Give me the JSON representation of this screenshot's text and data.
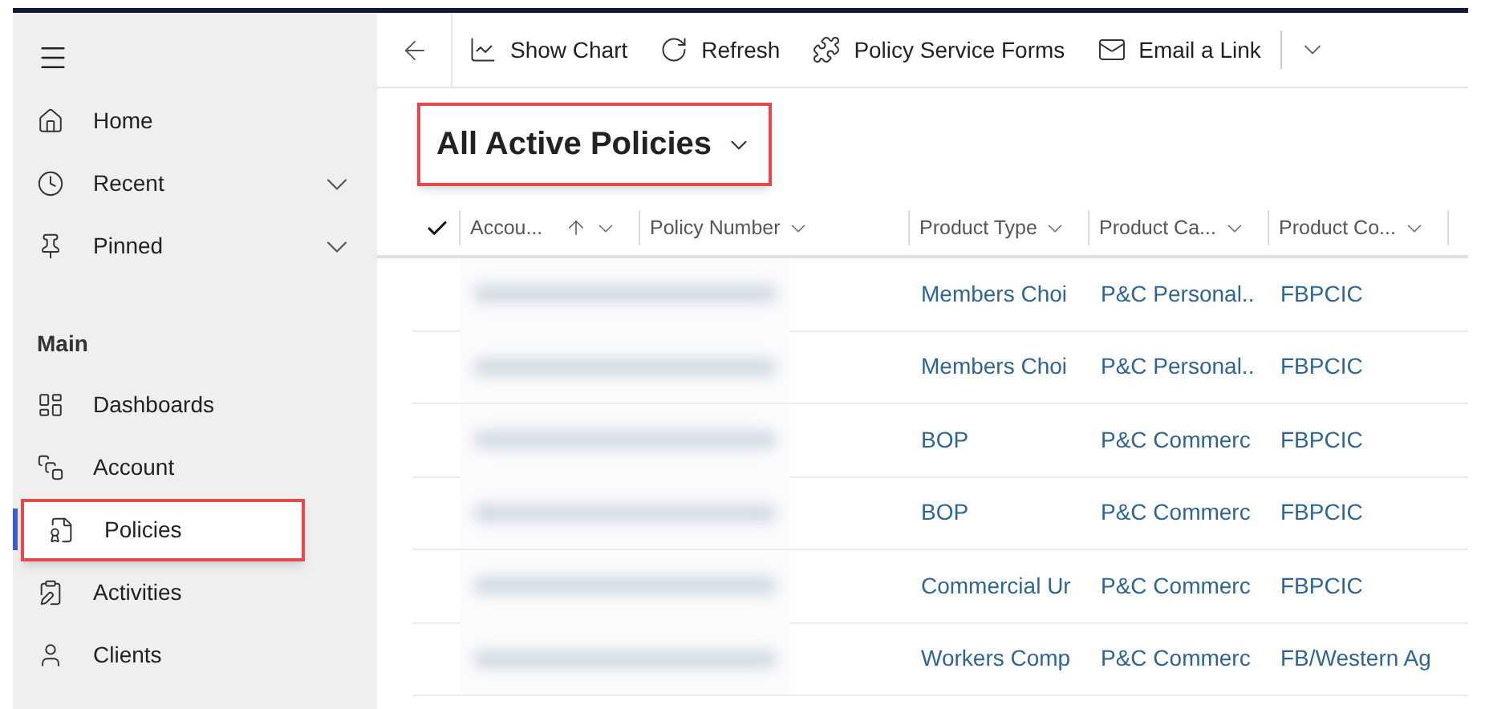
{
  "sidebar": {
    "groups": [
      {
        "items": [
          {
            "label": "Home",
            "expandable": false,
            "selected": false
          },
          {
            "label": "Recent",
            "expandable": true,
            "selected": false
          },
          {
            "label": "Pinned",
            "expandable": true,
            "selected": false
          }
        ]
      },
      {
        "title": "Main",
        "items": [
          {
            "label": "Dashboards",
            "expandable": false,
            "selected": false
          },
          {
            "label": "Account",
            "expandable": false,
            "selected": false
          },
          {
            "label": "Policies",
            "expandable": false,
            "selected": true
          },
          {
            "label": "Activities",
            "expandable": false,
            "selected": false
          },
          {
            "label": "Clients",
            "expandable": false,
            "selected": false
          }
        ]
      }
    ]
  },
  "toolbar": [
    {
      "label": "Show Chart"
    },
    {
      "label": "Refresh"
    },
    {
      "label": "Policy Service Forms"
    },
    {
      "label": "Email a Link"
    }
  ],
  "view": {
    "title": "All Active Policies"
  },
  "table": {
    "columns": [
      {
        "label": "Accou...",
        "sorted": true
      },
      {
        "label": "Policy Number",
        "sorted": false
      },
      {
        "label": "Product Type",
        "sorted": false
      },
      {
        "label": "Product Ca...",
        "sorted": false
      },
      {
        "label": "Product Co...",
        "sorted": false
      }
    ],
    "rows": [
      {
        "product_type": "Members Choi",
        "product_category": "P&C Personal..",
        "product_company": "FBPCIC"
      },
      {
        "product_type": "Members Choi",
        "product_category": "P&C Personal..",
        "product_company": "FBPCIC"
      },
      {
        "product_type": "BOP",
        "product_category": "P&C Commerc",
        "product_company": "FBPCIC"
      },
      {
        "product_type": "BOP",
        "product_category": "P&C Commerc",
        "product_company": "FBPCIC"
      },
      {
        "product_type": "Commercial Ur",
        "product_category": "P&C Commerc",
        "product_company": "FBPCIC"
      },
      {
        "product_type": "Workers Comp",
        "product_category": "P&C Commerc",
        "product_company": "FB/Western Ag"
      }
    ]
  }
}
